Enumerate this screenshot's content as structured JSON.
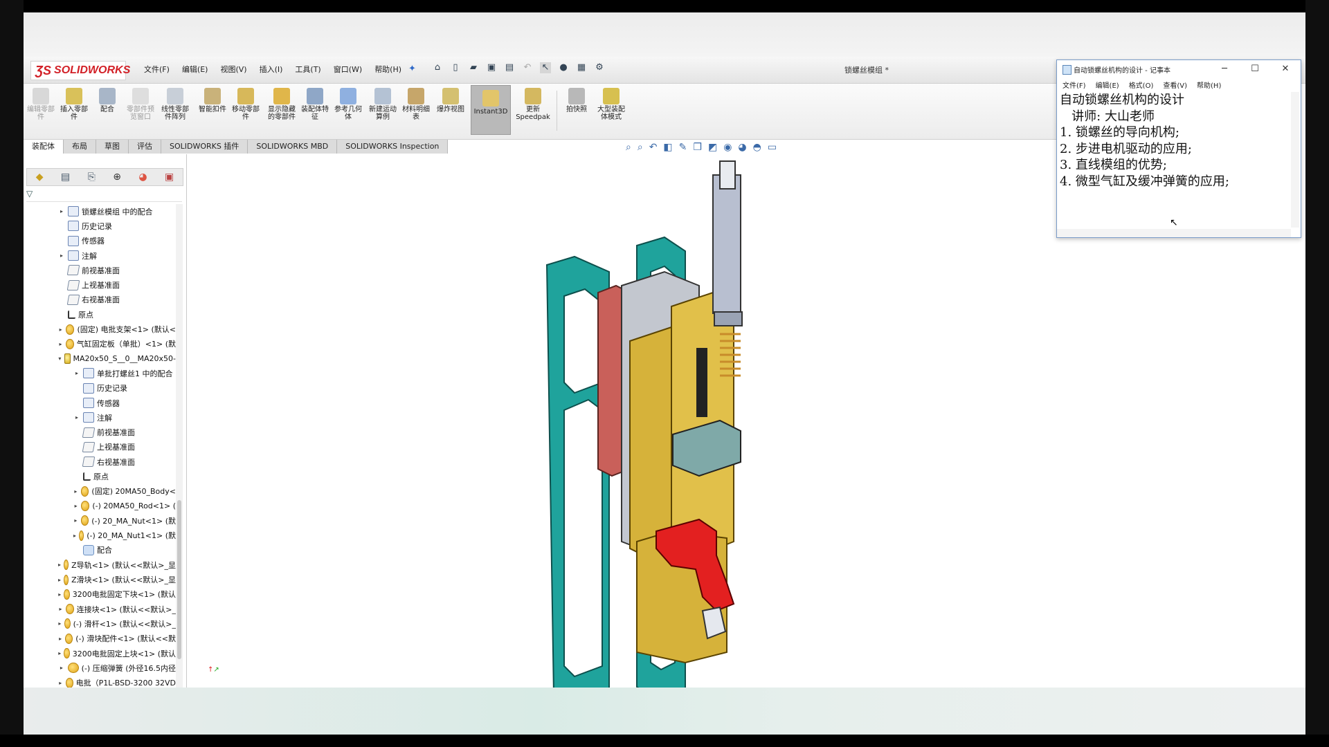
{
  "app": {
    "logo": "SOLIDWORKS",
    "menus": [
      "文件(F)",
      "编辑(E)",
      "视图(V)",
      "插入(I)",
      "工具(T)",
      "窗口(W)",
      "帮助(H)"
    ],
    "document_title": "锁螺丝模组 *"
  },
  "commands": [
    {
      "label": "编辑零部件",
      "disabled": true
    },
    {
      "label": "插入零部件",
      "disabled": false
    },
    {
      "label": "配合",
      "disabled": false
    },
    {
      "label": "零部件预览窗口",
      "disabled": true
    },
    {
      "label": "线性零部件阵列",
      "disabled": false
    },
    {
      "label": "智能扣件",
      "disabled": false
    },
    {
      "label": "移动零部件",
      "disabled": false
    },
    {
      "label": "显示隐藏的零部件",
      "disabled": false
    },
    {
      "label": "装配体特征",
      "disabled": false
    },
    {
      "label": "参考几何体",
      "disabled": false
    },
    {
      "label": "新建运动算例",
      "disabled": false
    },
    {
      "label": "材料明细表",
      "disabled": false
    },
    {
      "label": "爆炸视图",
      "disabled": false
    },
    {
      "label": "Instant3D",
      "disabled": false,
      "active": true
    },
    {
      "label": "更新Speedpak",
      "disabled": false
    },
    {
      "label": "拍快照",
      "disabled": false
    },
    {
      "label": "大型装配体模式",
      "disabled": false
    }
  ],
  "tabs": [
    "装配体",
    "布局",
    "草图",
    "评估",
    "SOLIDWORKS 插件",
    "SOLIDWORKS MBD",
    "SOLIDWORKS Inspection"
  ],
  "tree": [
    {
      "label": "锁螺丝模组 中的配合",
      "icon": "folder",
      "expand": "▸",
      "indent": 1
    },
    {
      "label": "历史记录",
      "icon": "folder",
      "expand": "",
      "indent": 1
    },
    {
      "label": "传感器",
      "icon": "folder",
      "expand": "",
      "indent": 1
    },
    {
      "label": "注解",
      "icon": "folder",
      "expand": "▸",
      "indent": 1
    },
    {
      "label": "前视基准面",
      "icon": "plane",
      "expand": "",
      "indent": 1
    },
    {
      "label": "上视基准面",
      "icon": "plane",
      "expand": "",
      "indent": 1
    },
    {
      "label": "右视基准面",
      "icon": "plane",
      "expand": "",
      "indent": 1
    },
    {
      "label": "原点",
      "icon": "origin",
      "expand": "",
      "indent": 1
    },
    {
      "label": "(固定) 电批支架<1> (默认<",
      "icon": "part",
      "expand": "▸",
      "indent": 1
    },
    {
      "label": "气缸固定板（单批）<1> (默",
      "icon": "part",
      "expand": "▸",
      "indent": 1
    },
    {
      "label": "MA20x50_S__0__MA20x50-",
      "icon": "asm",
      "expand": "▾",
      "indent": 1
    },
    {
      "label": "单批打螺丝1 中的配合",
      "icon": "folder",
      "expand": "▸",
      "indent": 2
    },
    {
      "label": "历史记录",
      "icon": "folder",
      "expand": "",
      "indent": 2
    },
    {
      "label": "传感器",
      "icon": "folder",
      "expand": "",
      "indent": 2
    },
    {
      "label": "注解",
      "icon": "folder",
      "expand": "▸",
      "indent": 2
    },
    {
      "label": "前视基准面",
      "icon": "plane",
      "expand": "",
      "indent": 2
    },
    {
      "label": "上视基准面",
      "icon": "plane",
      "expand": "",
      "indent": 2
    },
    {
      "label": "右视基准面",
      "icon": "plane",
      "expand": "",
      "indent": 2
    },
    {
      "label": "原点",
      "icon": "origin",
      "expand": "",
      "indent": 2
    },
    {
      "label": "(固定) 20MA50_Body<",
      "icon": "part",
      "expand": "▸",
      "indent": 2
    },
    {
      "label": "(-) 20MA50_Rod<1> (",
      "icon": "part",
      "expand": "▸",
      "indent": 2
    },
    {
      "label": "(-) 20_MA_Nut<1> (默",
      "icon": "part",
      "expand": "▸",
      "indent": 2
    },
    {
      "label": "(-) 20_MA_Nut1<1> (默",
      "icon": "part",
      "expand": "▸",
      "indent": 2
    },
    {
      "label": "配合",
      "icon": "mate",
      "expand": "",
      "indent": 2
    },
    {
      "label": "Z导轨<1> (默认<<默认>_显",
      "icon": "part",
      "expand": "▸",
      "indent": 1
    },
    {
      "label": "Z滑块<1> (默认<<默认>_显",
      "icon": "part",
      "expand": "▸",
      "indent": 1
    },
    {
      "label": "3200电批固定下块<1> (默认",
      "icon": "part",
      "expand": "▸",
      "indent": 1
    },
    {
      "label": "连接块<1> (默认<<默认>_",
      "icon": "part",
      "expand": "▸",
      "indent": 1
    },
    {
      "label": "(-) 滑杆<1> (默认<<默认>_",
      "icon": "part",
      "expand": "▸",
      "indent": 1
    },
    {
      "label": "(-) 滑块配件<1> (默认<<默",
      "icon": "part",
      "expand": "▸",
      "indent": 1
    },
    {
      "label": "3200电批固定上块<1> (默认",
      "icon": "part",
      "expand": "▸",
      "indent": 1
    },
    {
      "label": "(-) 压缩弹簧 (外径16.5内径",
      "icon": "part",
      "expand": "▸",
      "indent": 1
    },
    {
      "label": "电批（P1L-BSD-3200 32VD",
      "icon": "part",
      "expand": "▸",
      "indent": 1
    }
  ],
  "notepad": {
    "title": "自动锁螺丝机构的设计 - 记事本",
    "menus": [
      "文件(F)",
      "编辑(E)",
      "格式(O)",
      "查看(V)",
      "帮助(H)"
    ],
    "lines": [
      "自动锁螺丝机构的设计",
      "   讲师: 大山老师",
      "1. 锁螺丝的导向机构;",
      "2. 步进电机驱动的应用;",
      "3. 直线模组的优势;",
      "4. 微型气缸及缓冲弹簧的应用;"
    ]
  },
  "colors": {
    "frame_teal": "#1fa39c",
    "plate_red": "#c9605a",
    "brass": "#d6b23a",
    "bracket_red": "#e32020",
    "steel": "#b8bfd0",
    "logo_red": "#d21f26"
  }
}
